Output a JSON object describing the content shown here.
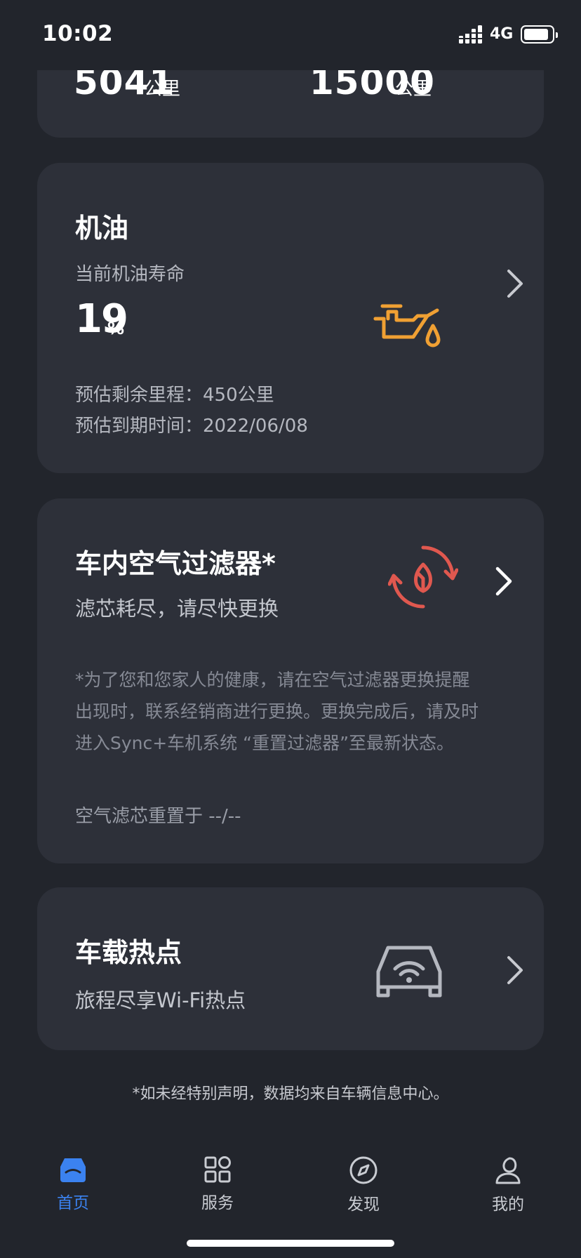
{
  "status_bar": {
    "time": "10:02",
    "network": "4G",
    "battery_level": 0.8
  },
  "mileage_card": {
    "left_value": "5041",
    "left_unit": "公里",
    "right_value": "15000",
    "right_unit": "公里"
  },
  "oil_card": {
    "title": "机油",
    "life_label": "当前机油寿命",
    "life_value": "19",
    "life_unit": "%",
    "remaining_range": "预估剩余里程：450公里",
    "due_date": "预估到期时间：2022/06/08",
    "icon": "oil-can-icon",
    "icon_color": "#f0a033"
  },
  "filter_card": {
    "title": "车内空气过滤器*",
    "status": "滤芯耗尽，请尽快更换",
    "note_line1": "*为了您和您家人的健康，请在空气过滤器更换提醒",
    "note_line2": "出现时，联系经销商进行更换。更换完成后，请及时",
    "note_line3": "进入Sync+车机系统 “重置过滤器”至最新状态。",
    "reset_info": "空气滤芯重置于 --/--",
    "icon": "leaf-refresh-icon",
    "icon_color": "#e0584f"
  },
  "hotspot_card": {
    "title": "车载热点",
    "subtitle": "旅程尽享Wi-Fi热点",
    "icon": "car-wifi-icon"
  },
  "footnote": "*如未经特别声明，数据均来自车辆信息中心。",
  "tabbar": {
    "accent_color": "#3b82f0",
    "tabs": [
      {
        "label": "首页",
        "icon": "home-car-icon",
        "active": true
      },
      {
        "label": "服务",
        "icon": "grid-icon",
        "active": false
      },
      {
        "label": "发现",
        "icon": "compass-icon",
        "active": false
      },
      {
        "label": "我的",
        "icon": "user-icon",
        "active": false
      }
    ]
  }
}
